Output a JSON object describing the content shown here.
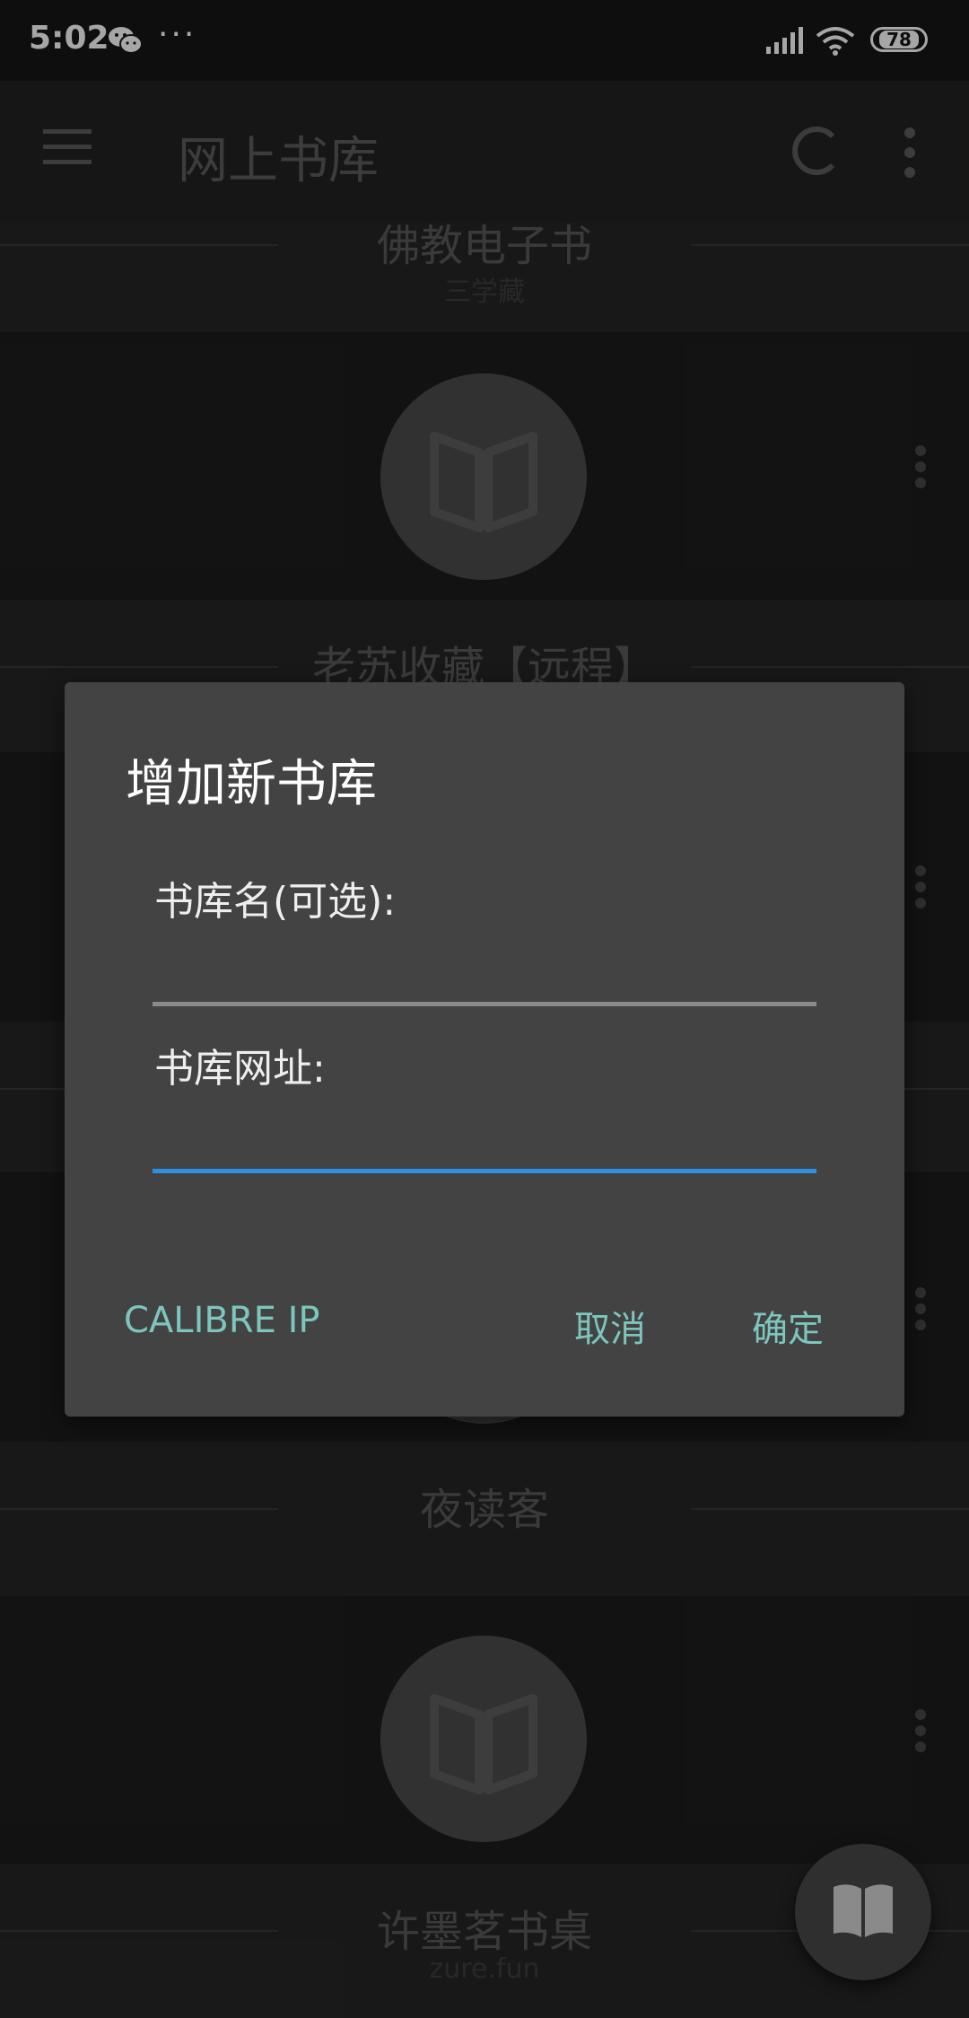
{
  "status_bar": {
    "time": "5:02",
    "more_dots": "···",
    "battery": "78",
    "icons": [
      "wechat-icon",
      "signal-icon",
      "wifi-icon",
      "battery-icon"
    ]
  },
  "app_bar": {
    "title": "网上书库",
    "icons": [
      "menu-icon",
      "refresh-icon",
      "more-vert-icon"
    ]
  },
  "libraries": [
    {
      "name": "佛教电子书",
      "subtitle": "三学藏"
    },
    {
      "name": "老苏收藏【远程】",
      "subtitle": ""
    },
    {
      "name": "夜读客",
      "subtitle": ""
    },
    {
      "name": "许墨茗书桌",
      "subtitle": "zure.fun"
    }
  ],
  "dialog": {
    "title": "增加新书库",
    "name_label": "书库名(可选):",
    "name_value": "",
    "url_label": "书库网址:",
    "url_value": "",
    "buttons": {
      "calibre": "CALIBRE IP",
      "cancel": "取消",
      "ok": "确定"
    },
    "accent_color": "#7cc6bd",
    "focus_color": "#2f8fe0"
  },
  "fab": {
    "icon": "open-book-icon"
  }
}
